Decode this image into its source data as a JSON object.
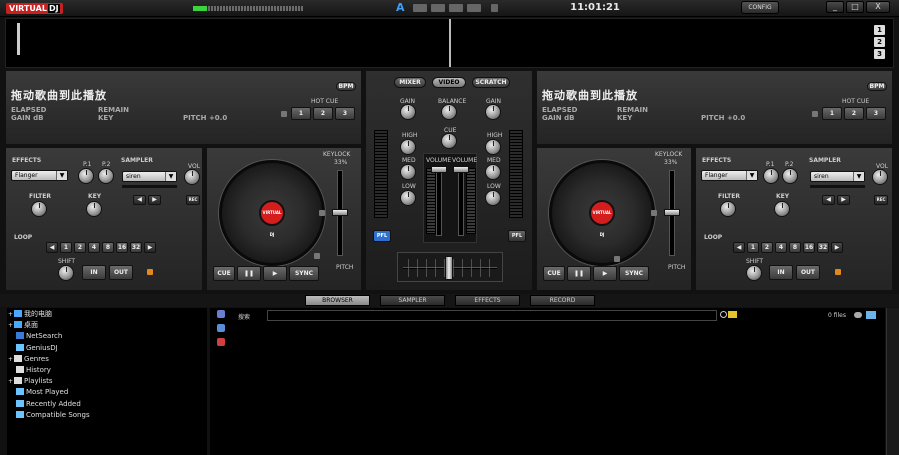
{
  "app": {
    "logo_virtual": "VIRTUAL",
    "logo_dj": "DJ",
    "clock": "11:01:21",
    "config_label": "CONFIG",
    "minimize": "_",
    "maximize": "□",
    "close": "X",
    "a_label": "A"
  },
  "zoom_buttons": [
    "1",
    "2",
    "3"
  ],
  "deck_left": {
    "title": "拖动歌曲到此播放",
    "bpm_label": "BPM",
    "elapsed": "ELAPSED",
    "gain": "GAIN dB",
    "remain": "REMAIN",
    "key": "KEY",
    "pitch": "PITCH +0.0",
    "hot_cue": "HOT CUE",
    "hot_cues": [
      "1",
      "2",
      "3"
    ],
    "effects": "EFFECTS",
    "effect_value": "Flanger",
    "p1": "P.1",
    "p2": "P.2",
    "filter": "FILTER",
    "key_knob": "KEY",
    "sampler": "SAMPLER",
    "vol": "VOL",
    "sampler_value": "siren",
    "rec": "REC",
    "loop": "LOOP",
    "loop_values": [
      "1",
      "2",
      "4",
      "8",
      "16",
      "32"
    ],
    "shift": "SHIFT",
    "in": "IN",
    "out": "OUT",
    "keylock": "KEYLOCK",
    "keylock_pct": "33%",
    "pitch_label": "PITCH",
    "cue": "CUE",
    "pause": "❚❚",
    "play": "▶",
    "sync": "SYNC",
    "platter_label": "VIRTUAL DJ"
  },
  "deck_right": {
    "title": "拖动歌曲到此播放",
    "bpm_label": "BPM",
    "elapsed": "ELAPSED",
    "gain": "GAIN dB",
    "remain": "REMAIN",
    "key": "KEY",
    "pitch": "PITCH +0.0",
    "hot_cue": "HOT CUE",
    "hot_cues": [
      "1",
      "2",
      "3"
    ],
    "effects": "EFFECTS",
    "effect_value": "Flanger",
    "p1": "P.1",
    "p2": "P.2",
    "filter": "FILTER",
    "key_knob": "KEY",
    "sampler": "SAMPLER",
    "vol": "VOL",
    "sampler_value": "siren",
    "rec": "REC",
    "loop": "LOOP",
    "loop_values": [
      "1",
      "2",
      "4",
      "8",
      "16",
      "32"
    ],
    "shift": "SHIFT",
    "in": "IN",
    "out": "OUT",
    "keylock": "KEYLOCK",
    "keylock_pct": "33%",
    "pitch_label": "PITCH",
    "cue": "CUE",
    "pause": "❚❚",
    "play": "▶",
    "sync": "SYNC",
    "platter_label": "VIRTUAL DJ"
  },
  "mixer": {
    "tabs": [
      "MIXER",
      "VIDEO",
      "SCRATCH"
    ],
    "active_tab": "VIDEO",
    "gain": "GAIN",
    "balance": "BALANCE",
    "cue": "CUE",
    "high": "HIGH",
    "med": "MED",
    "low": "LOW",
    "volume": "VOLUME",
    "pfl": "PFL"
  },
  "browser": {
    "tabs": [
      "BROWSER",
      "SAMPLER",
      "EFFECTS",
      "RECORD"
    ],
    "active_tab": "BROWSER",
    "search_label": "搜索",
    "file_count": "0 files",
    "tree": [
      {
        "label": "我的电脑",
        "icon": "computer-icon",
        "color": "#4aa8ff"
      },
      {
        "label": "桌面",
        "icon": "desktop-icon",
        "color": "#4aa8ff"
      },
      {
        "label": "NetSearch",
        "icon": "netsearch-icon",
        "color": "#3a7bd5"
      },
      {
        "label": "GeniusDJ",
        "icon": "geniusdj-icon",
        "color": "#6cc4ff"
      },
      {
        "label": "Genres",
        "icon": "genres-icon",
        "color": "#ddd"
      },
      {
        "label": "History",
        "icon": "history-icon",
        "color": "#ddd"
      },
      {
        "label": "Playlists",
        "icon": "playlists-icon",
        "color": "#ddd"
      },
      {
        "label": "Most Played",
        "icon": "most-played-icon",
        "color": "#6cc4ff"
      },
      {
        "label": "Recently Added",
        "icon": "recently-added-icon",
        "color": "#6cc4ff"
      },
      {
        "label": "Compatible Songs",
        "icon": "compatible-songs-icon",
        "color": "#6cc4ff"
      }
    ]
  }
}
